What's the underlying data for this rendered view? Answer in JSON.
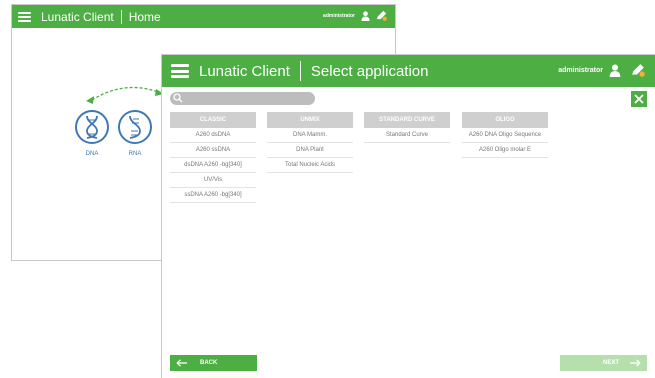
{
  "home": {
    "app_title": "Lunatic Client",
    "page_title": "Home",
    "user": "administrator",
    "apps": [
      {
        "label": "DNA"
      },
      {
        "label": "RNA"
      }
    ]
  },
  "select": {
    "app_title": "Lunatic Client",
    "page_title": "Select application",
    "user": "administrator",
    "search_placeholder": "",
    "columns": [
      {
        "header": "CLASSIC",
        "items": [
          "A260 dsDNA",
          "A260 ssDNA",
          "dsDNA A260 -bg[340]",
          "UV/Vis",
          "ssDNA A260 -bg[340]"
        ]
      },
      {
        "header": "UNMIX",
        "items": [
          "DNA Mamm.",
          "DNA Plant",
          "Total Nucleic Acids"
        ]
      },
      {
        "header": "STANDARD CURVE",
        "items": [
          "Standard Curve"
        ]
      },
      {
        "header": "OLIGO",
        "items": [
          "A260 DNA Oligo Sequence",
          "A260 Oligo molar E"
        ]
      }
    ],
    "back_label": "BACK",
    "next_label": "NEXT"
  },
  "colors": {
    "green": "#4cae43",
    "green_disabled": "#b5e0ac",
    "header_gray": "#cfcfcf",
    "icon_blue": "#3f78b5"
  },
  "icons": [
    "menu-icon",
    "user-icon",
    "edit-icon",
    "search-icon",
    "close-icon",
    "arrow-left-icon",
    "arrow-right-icon",
    "dna-icon"
  ]
}
